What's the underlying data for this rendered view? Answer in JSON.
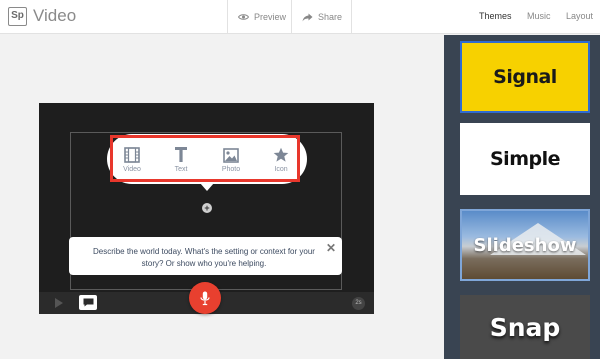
{
  "app": {
    "logo": "Sp",
    "title": "Video"
  },
  "toolbar": {
    "preview_label": "Preview",
    "share_label": "Share"
  },
  "tabs": [
    {
      "label": "Themes",
      "active": true
    },
    {
      "label": "Music",
      "active": false
    },
    {
      "label": "Layout",
      "active": false
    }
  ],
  "themes": [
    {
      "label": "Signal",
      "selected": true
    },
    {
      "label": "Simple",
      "selected": false
    },
    {
      "label": "Slideshow",
      "selected": false
    },
    {
      "label": "Snap",
      "selected": false
    }
  ],
  "content_picker": {
    "items": [
      {
        "label": "Video",
        "icon": "film-icon"
      },
      {
        "label": "Text",
        "icon": "text-icon"
      },
      {
        "label": "Photo",
        "icon": "photo-icon"
      },
      {
        "label": "Icon",
        "icon": "star-icon"
      }
    ]
  },
  "prompt": {
    "text": "Describe the world today. What's the setting or context for your story? Or show who you're helping.",
    "close_symbol": "✕"
  },
  "controls": {
    "duration": "2s"
  },
  "colors": {
    "accent_red": "#e8402f",
    "signal_yellow": "#f7d100",
    "side_panel": "#394452",
    "selection_blue": "#2f6bd1"
  }
}
